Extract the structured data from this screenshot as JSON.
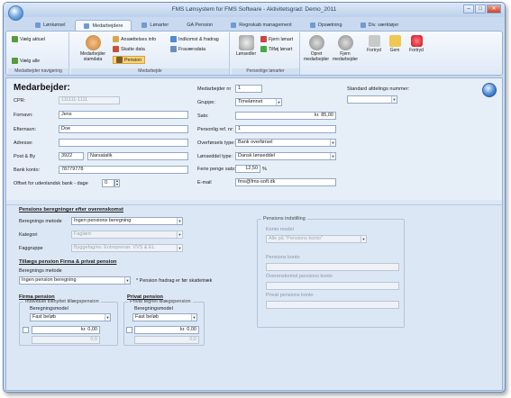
{
  "window": {
    "title": "FMS Lønsystem for FMS Software - Aktivitetsgrad: Demo_2011"
  },
  "tabs": [
    {
      "label": "Lønkørsel",
      "active": false
    },
    {
      "label": "Medarbejdere",
      "active": true
    },
    {
      "label": "Lønarter",
      "active": false
    },
    {
      "label": "GA Pension",
      "active": false
    },
    {
      "label": "Regnskab management",
      "active": false
    },
    {
      "label": "Opsætning",
      "active": false
    },
    {
      "label": "Div. værktøjer",
      "active": false
    }
  ],
  "ribbon": {
    "nav": {
      "vaelg_aktuel": "Vælg aktuel",
      "vaelg_alle": "Vælg alle",
      "group": "Medarbejder navigering"
    },
    "medarbejde": {
      "medarbejder_stamdata": "Medarbejder stamdata",
      "ansaettelses_info": "Ansættelses info",
      "skatte_data": "Skatte data",
      "pension": "Pension",
      "indkomst": "Indkomst & fradrag",
      "fravaersdata": "Fraværsdata",
      "group": "Medarbejde"
    },
    "personlige": {
      "lonsedler": "Lønsedler",
      "fjern_lonart": "Fjern lønart",
      "tilfoj_lonart": "Tilføj lønart",
      "group": "Personlige lønarter"
    },
    "actions": {
      "opret": "Opret medarbejder",
      "fjern": "Fjern medarbejder",
      "fortryd": "Fortryd",
      "gem": "Gem",
      "fortryd2": "Fortryd"
    }
  },
  "form": {
    "heading": "Medarbejder:",
    "cpr_label": "CPR:",
    "cpr_value": "111111-1111",
    "fornavn_label": "Fornavn:",
    "fornavn_value": "Jens",
    "efternavn_label": "Efternavn:",
    "efternavn_value": "Doe",
    "adresse_label": "Adresse:",
    "adresse_value": "",
    "postby_label": "Post & By",
    "post_value": "3922",
    "by_value": "Narsatalik",
    "bankkonto_label": "Bank konto:",
    "bankkonto_value": "78779778",
    "offset_label": "Offset for udenlandsk bank - dage",
    "offset_value": "0",
    "medarbnr_label": "Medarbejder nr",
    "medarbnr_value": "1",
    "gruppe_label": "Gruppe:",
    "gruppe_value": "Timelønnet",
    "sats_label": "Sats:",
    "sats_value": "kr. 85,00",
    "persref_label": "Personlig ref. nr:",
    "persref_value": "1",
    "overfoersel_label": "Overførsels type:",
    "overfoersel_value": "Bank overførsel",
    "lonseddel_label": "Lønseddel type:",
    "lonseddel_value": "Dansk lønseddel",
    "ferie_label": "Ferie penge sats:",
    "ferie_value": "12,50",
    "ferie_unit": "%",
    "email_label": "E-mail",
    "email_value": "fms@fms-soft.dk",
    "standard_afd_label": "Standard afdelings nummer:",
    "standard_afd_value": ""
  },
  "pension": {
    "sec_title": "Pensions beregninger efter overenskomst",
    "beregnings_label": "Beregnings metode",
    "beregnings_value": "Ingen pensions beregning",
    "kategori_label": "Kategori",
    "kategori_value": "Faglært",
    "faggruppe_label": "Faggruppe",
    "faggruppe_value": "Byggefag/ev. Entreprenør. VVS & EL",
    "tillaeg_title": "Tillægs pension Firma & privat pension",
    "tillaeg_method_label": "Beregnings metode",
    "tillaeg_method_value": "Ingen pension beregning",
    "note": "* Pension fradrag er før skattetræk",
    "firma_title": "Firma pension",
    "firma_legend": "Individuel tilknyttet tillægspension",
    "firma_model_label": "Beregningsmodel",
    "firma_model_value": "Fast beløb",
    "firma_amount": "kr. 0,00",
    "firma_pct": "0,0",
    "privat_title": "Privat pension",
    "privat_legend": "Privat tegnet tillægspension",
    "privat_model_label": "Beregningsmodel",
    "privat_model_value": "Fast beløb",
    "privat_amount": "kr. 0,00",
    "privat_pct": "0,0",
    "indst_legend": "Pensions indstilling",
    "konto_model_label": "Konto model",
    "konto_model_value": "Alle på \"Pensions konto\"",
    "pens_konto_label": "Pensions konto",
    "overenskomst_konto_label": "Overenskomst pensions konto",
    "privat_konto_label": "Privat pensions konto"
  },
  "colors": {
    "accent": "#4a7fc0",
    "ribbon": "#dfe9f6",
    "background": "#dce7f5"
  }
}
